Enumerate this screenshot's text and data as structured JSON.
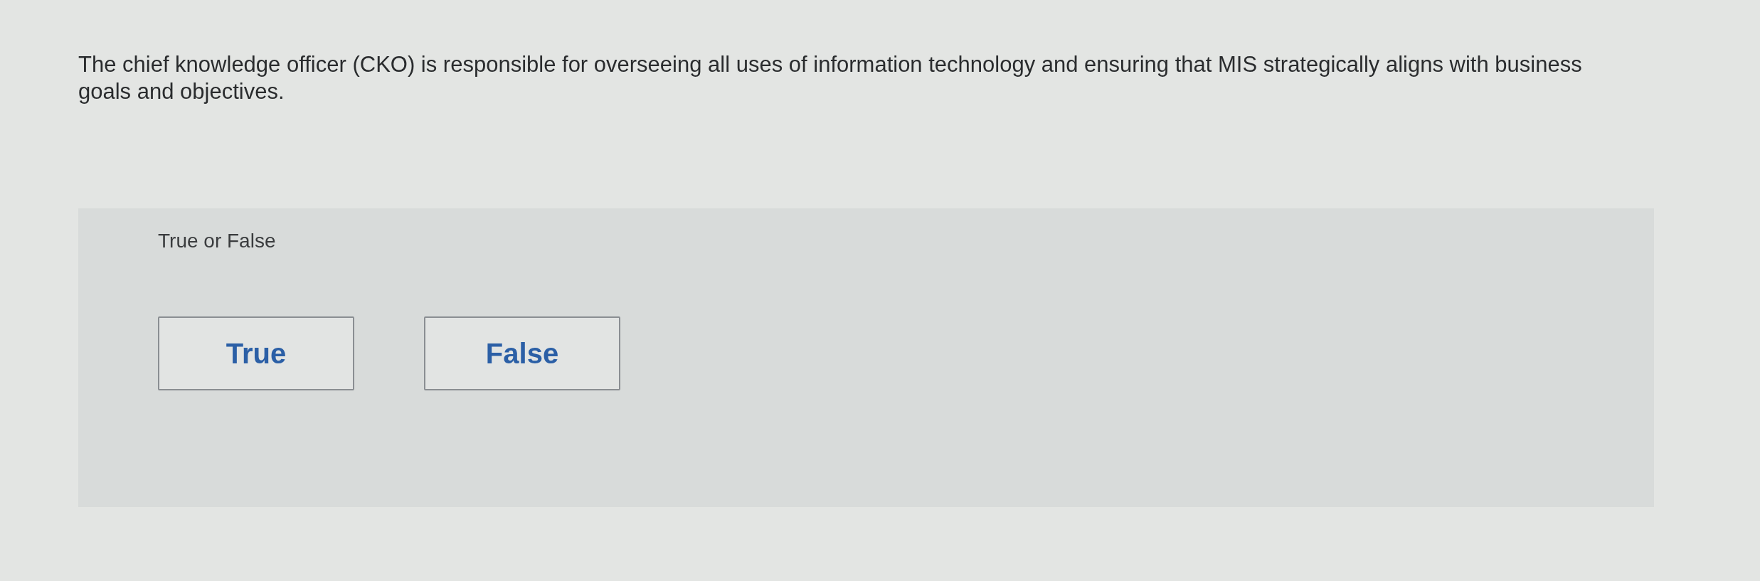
{
  "question": "The chief knowledge officer (CKO) is responsible for overseeing all uses of information technology and ensuring that MIS strategically aligns with business goals and objectives.",
  "prompt": "True or False",
  "options": [
    {
      "label": "True"
    },
    {
      "label": "False"
    }
  ]
}
